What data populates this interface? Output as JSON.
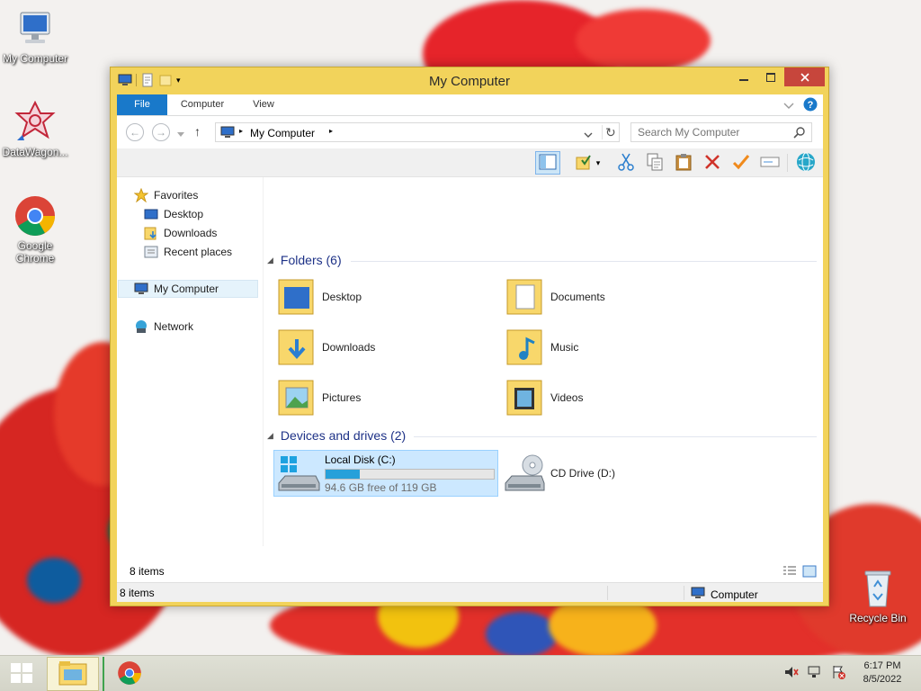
{
  "desktop": {
    "icons": [
      {
        "label": "My Computer"
      },
      {
        "label": "DataWagon..."
      },
      {
        "label": "Google Chrome"
      },
      {
        "label": "Recycle Bin"
      }
    ]
  },
  "window": {
    "title": "My Computer",
    "ribbon_tabs": [
      "File",
      "Computer",
      "View"
    ],
    "address": {
      "location": "My Computer"
    },
    "search": {
      "placeholder": "Search My Computer"
    },
    "nav_pane": {
      "favorites": "Favorites",
      "favorites_items": [
        "Desktop",
        "Downloads",
        "Recent places"
      ],
      "computer": "My Computer",
      "network": "Network"
    },
    "groups": {
      "folders": {
        "header": "Folders (6)",
        "items": [
          "Desktop",
          "Documents",
          "Downloads",
          "Music",
          "Pictures",
          "Videos"
        ]
      },
      "devices": {
        "header": "Devices and drives (2)",
        "drives": [
          {
            "name": "Local Disk (C:)",
            "free_text": "94.6 GB free of 119 GB",
            "used_fraction": 0.205
          },
          {
            "name": "CD Drive (D:)"
          }
        ]
      }
    },
    "items_count": "8 items",
    "statusbar": {
      "left": "8 items",
      "right": "Computer"
    }
  },
  "taskbar": {
    "time": "6:17 PM",
    "date": "8/5/2022"
  },
  "colors": {
    "window_frame": "#f2d35b",
    "file_tab": "#1979ca",
    "close_button": "#c7463c",
    "drive_bar": "#26a0da",
    "group_header": "#1e3287"
  }
}
